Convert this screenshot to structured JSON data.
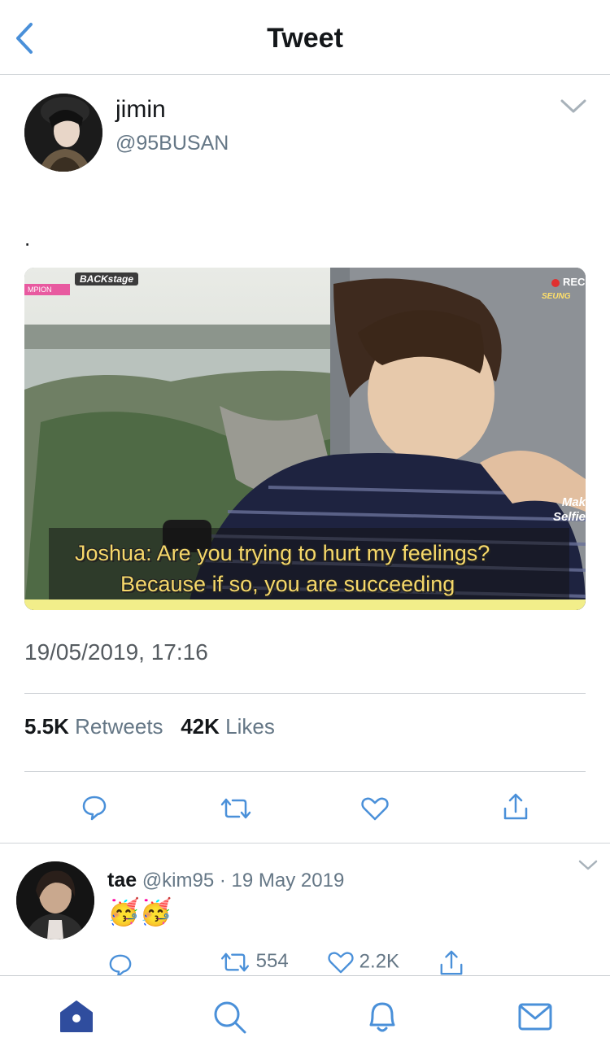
{
  "nav": {
    "title": "Tweet"
  },
  "tweet": {
    "name": "jimin",
    "handle": "@95BUSAN",
    "text": ".",
    "media": {
      "corner_tag": "BACKstage",
      "pink_tag": "MPION",
      "rec": "REC",
      "seung": "SEUNG",
      "mak": "Mak Selfie",
      "subtitle_line1": "Joshua: Are you trying to hurt my feelings?",
      "subtitle_line2": "Because if so, you are succeeding"
    },
    "timestamp": "19/05/2019, 17:16",
    "retweets_count": "5.5K",
    "retweets_label": "Retweets",
    "likes_count": "42K",
    "likes_label": "Likes"
  },
  "reply": {
    "name": "tae",
    "handle": "@kim95",
    "separator": "·",
    "date": "19 May 2019",
    "emoji": "🥳🥳",
    "retweets": "554",
    "likes": "2.2K"
  },
  "icons": {
    "back": "chevron-left-icon",
    "reply": "speech-bubble-icon",
    "retweet": "retweet-icon",
    "like": "heart-icon",
    "share": "share-icon",
    "home": "home-icon",
    "search": "search-icon",
    "notifications": "bell-icon",
    "messages": "mail-icon"
  },
  "colors": {
    "accent": "#1da1f2",
    "tab_active": "#2f4d9e",
    "icon_gray": "#657786",
    "subtitle_yellow": "#f6d86a"
  }
}
